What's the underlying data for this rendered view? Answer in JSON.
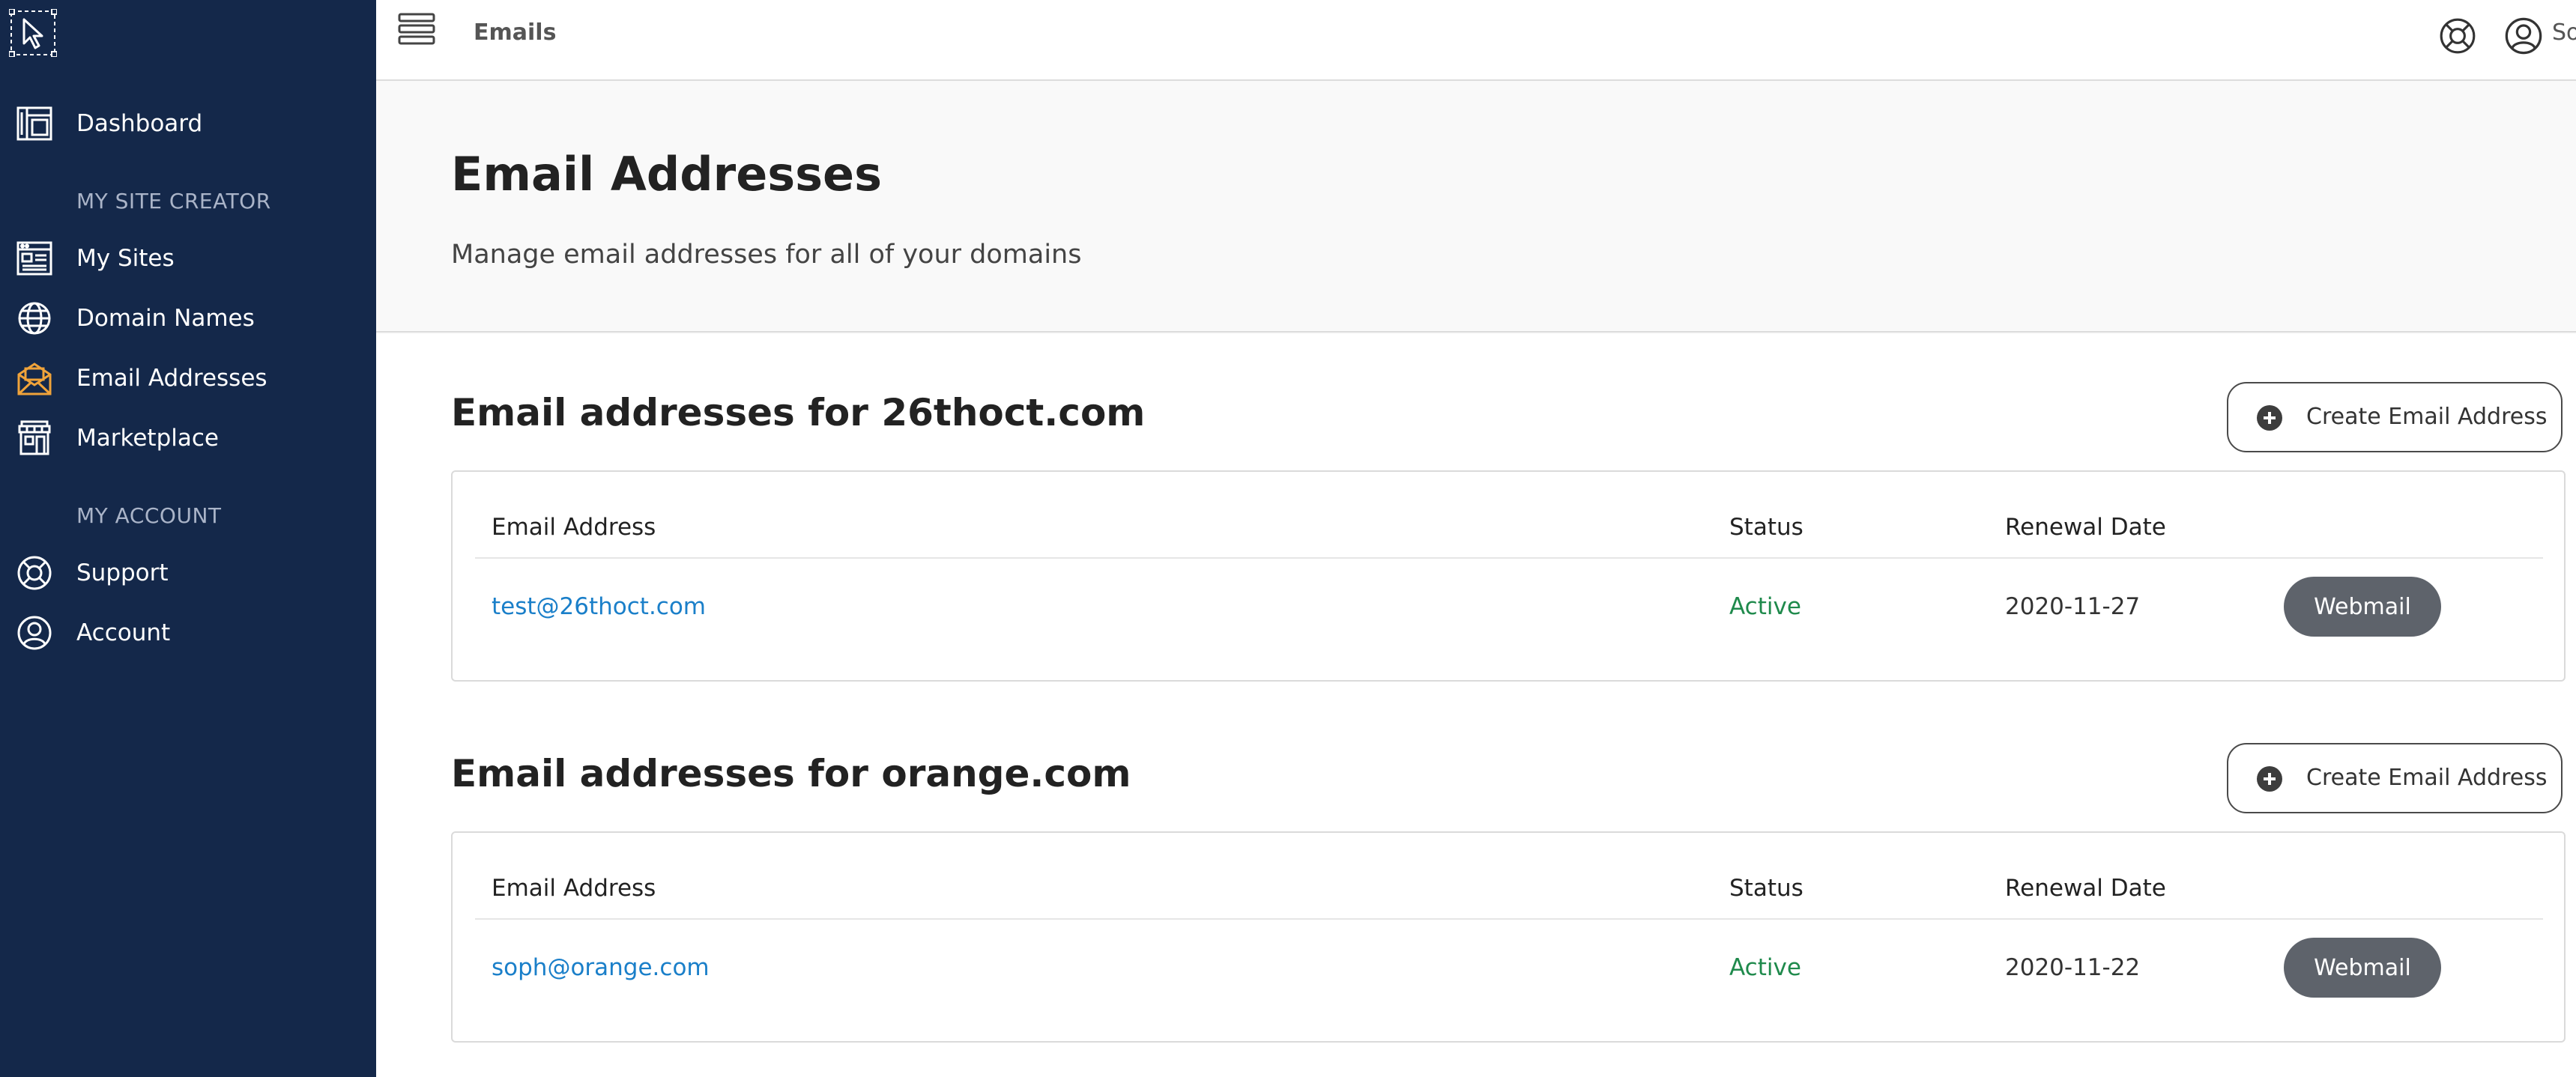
{
  "topbar": {
    "title": "Emails",
    "account_name": "Sophie"
  },
  "sidebar": {
    "items": [
      {
        "label": "Dashboard",
        "icon": "dashboard-icon"
      },
      {
        "label": "My Sites",
        "icon": "sites-icon"
      },
      {
        "label": "Domain Names",
        "icon": "globe-icon"
      },
      {
        "label": "Email Addresses",
        "icon": "envelope-icon",
        "active": true
      },
      {
        "label": "Marketplace",
        "icon": "store-icon"
      },
      {
        "label": "Support",
        "icon": "lifebuoy-icon"
      },
      {
        "label": "Account",
        "icon": "user-icon"
      }
    ],
    "sections": [
      "MY SITE CREATOR",
      "MY ACCOUNT"
    ]
  },
  "header": {
    "title": "Email Addresses",
    "subtitle": "Manage email addresses for all of your domains"
  },
  "groups": [
    {
      "title": "Email addresses for 26thoct.com",
      "create_label": "Create Email Address",
      "columns": [
        "Email Address",
        "Status",
        "Renewal Date"
      ],
      "rows": [
        {
          "email": "test@26thoct.com",
          "status": "Active",
          "renewal": "2020-11-27",
          "action": "Webmail"
        }
      ]
    },
    {
      "title": "Email addresses for orange.com",
      "create_label": "Create Email Address",
      "columns": [
        "Email Address",
        "Status",
        "Renewal Date"
      ],
      "rows": [
        {
          "email": "soph@orange.com",
          "status": "Active",
          "renewal": "2020-11-22",
          "action": "Webmail"
        }
      ]
    }
  ],
  "colors": {
    "sidebar_bg": "#14284a",
    "active_icon": "#f0a33a",
    "link": "#1a7fc9",
    "active_status": "#1f8a4c",
    "webmail_button": "#5e636b"
  }
}
